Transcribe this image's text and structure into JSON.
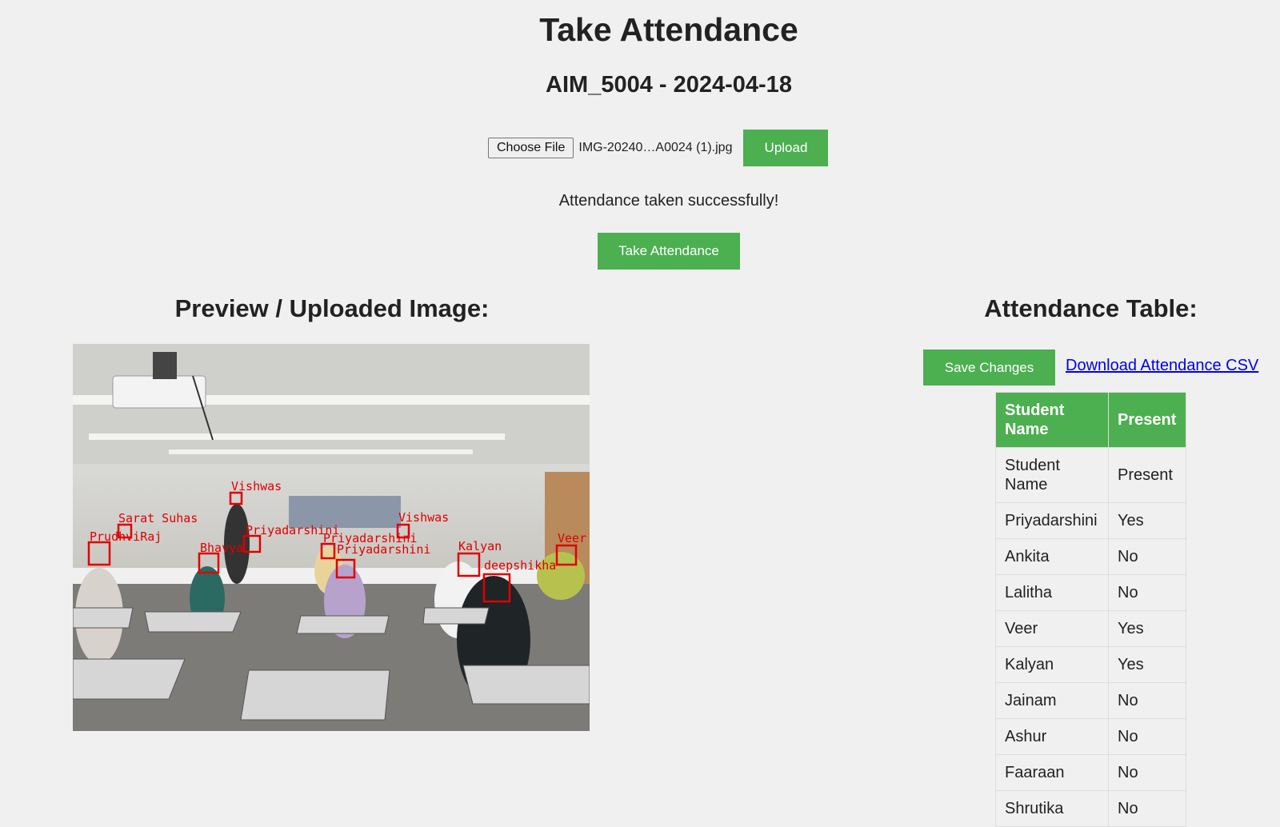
{
  "page": {
    "title": "Take Attendance",
    "subtitle": "AIM_5004 - 2024-04-18"
  },
  "upload": {
    "choose_file_label": "Choose File",
    "file_name": "IMG-20240…A0024 (1).jpg",
    "upload_label": "Upload"
  },
  "status_message": "Attendance taken successfully!",
  "take_attendance_label": "Take Attendance",
  "preview": {
    "heading": "Preview / Uploaded Image:",
    "face_labels": [
      "Vishwas",
      "Sarat Suhas",
      "PrudhviRaj",
      "Priyadarshini",
      "Bhavya",
      "Priyadarshini",
      "Priyadarshini",
      "Vishwas",
      "Kalyan",
      "Veer",
      "deepshikha"
    ]
  },
  "attendance": {
    "heading": "Attendance Table:",
    "save_label": "Save Changes",
    "download_label": "Download Attendance CSV",
    "columns": [
      "Student Name",
      "Present"
    ],
    "rows": [
      {
        "name": "Student Name",
        "present": "Present"
      },
      {
        "name": "Priyadarshini",
        "present": "Yes"
      },
      {
        "name": "Ankita",
        "present": "No"
      },
      {
        "name": "Lalitha",
        "present": "No"
      },
      {
        "name": "Veer",
        "present": "Yes"
      },
      {
        "name": "Kalyan",
        "present": "Yes"
      },
      {
        "name": "Jainam",
        "present": "No"
      },
      {
        "name": "Ashur",
        "present": "No"
      },
      {
        "name": "Faaraan",
        "present": "No"
      },
      {
        "name": "Shrutika",
        "present": "No"
      }
    ]
  },
  "colors": {
    "accent_green": "#4caf50",
    "background": "#f0f0f0",
    "face_box_red": "#e00000",
    "link_blue": "#0000ee"
  }
}
